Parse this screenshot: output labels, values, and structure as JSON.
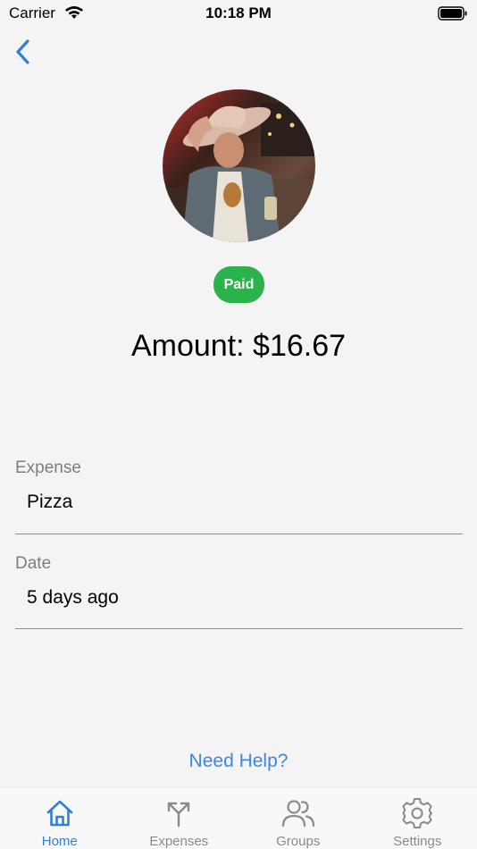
{
  "status_bar": {
    "carrier": "Carrier",
    "time": "10:18 PM"
  },
  "icons": {
    "back": "chevron-left-icon",
    "wifi": "wifi-icon",
    "battery": "battery-icon"
  },
  "colors": {
    "accent": "#2f7fdc",
    "paid_badge": "#2ab24b",
    "link": "#3b86e0",
    "background": "#f4f4f4"
  },
  "detail": {
    "status_badge": "Paid",
    "amount_label": "Amount:",
    "amount_value": "$16.67"
  },
  "fields": [
    {
      "label": "Expense",
      "value": "Pizza"
    },
    {
      "label": "Date",
      "value": "5 days ago"
    }
  ],
  "help_link": "Need Help?",
  "tabs": [
    {
      "label": "Home",
      "icon": "home-icon",
      "active": true
    },
    {
      "label": "Expenses",
      "icon": "split-arrows-icon",
      "active": false
    },
    {
      "label": "Groups",
      "icon": "people-icon",
      "active": false
    },
    {
      "label": "Settings",
      "icon": "gear-icon",
      "active": false
    }
  ]
}
